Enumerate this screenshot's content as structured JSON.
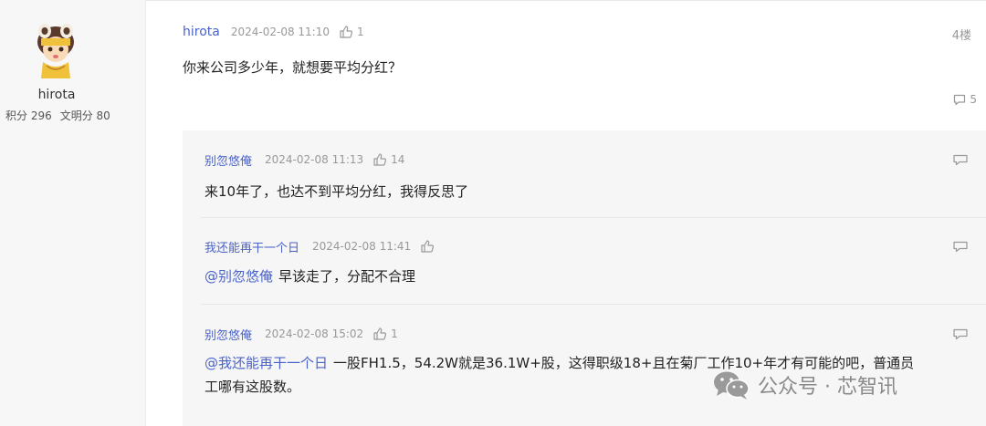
{
  "user": {
    "name": "hirota",
    "points_label": "积分 296",
    "article_points_label": "文明分 80"
  },
  "post": {
    "author": "hirota",
    "time": "2024-02-08 11:10",
    "likes": "1",
    "floor": "4楼",
    "content": "你来公司多少年，就想要平均分红？",
    "reply_count": "5"
  },
  "replies": [
    {
      "author": "别忽悠俺",
      "time": "2024-02-08 11:13",
      "likes": "14",
      "mention": "",
      "text": "来10年了，也达不到平均分红，我得反思了"
    },
    {
      "author": "我还能再干一个日",
      "time": "2024-02-08 11:41",
      "likes": "",
      "mention": "@别忽悠俺",
      "text": "早该走了，分配不合理"
    },
    {
      "author": "别忽悠俺",
      "time": "2024-02-08 15:02",
      "likes": "1",
      "mention": "@我还能再干一个日",
      "text": "一股FH1.5，54.2W就是36.1W+股，这得职级18+且在菊厂工作10+年才有可能的吧，普通员",
      "text2": "工哪有这股数。"
    }
  ],
  "watermark": {
    "text": "公众号 · 芯智讯"
  },
  "colors": {
    "link": "#4a63c9",
    "muted": "#999999"
  }
}
